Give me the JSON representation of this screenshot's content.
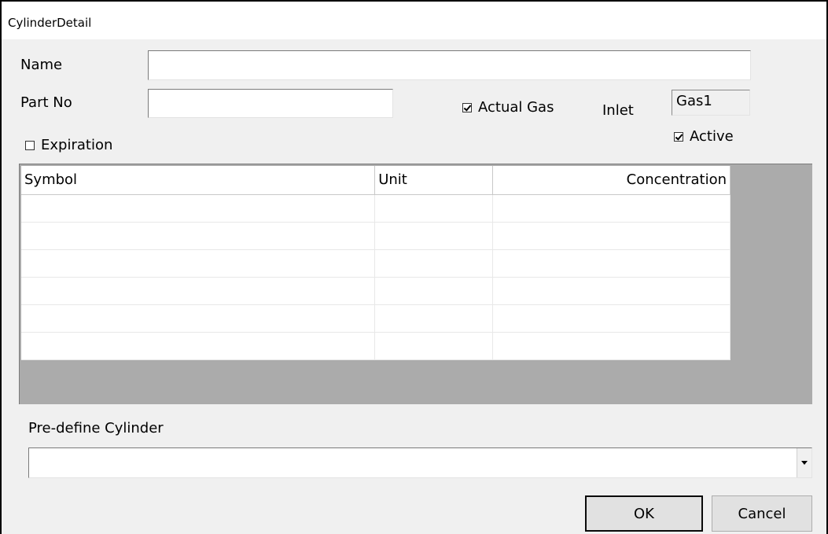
{
  "window": {
    "title": "CylinderDetail"
  },
  "form": {
    "name_label": "Name",
    "name_value": "",
    "partno_label": "Part No",
    "partno_value": "",
    "actual_gas_label": "Actual Gas",
    "actual_gas_checked": true,
    "inlet_label": "Inlet",
    "inlet_value": "Gas1",
    "active_label": "Active",
    "active_checked": true,
    "expiration_label": "Expiration",
    "expiration_checked": false
  },
  "grid": {
    "columns": [
      "Symbol",
      "Unit",
      "Concentration"
    ],
    "rows": [
      [
        "",
        "",
        ""
      ],
      [
        "",
        "",
        ""
      ],
      [
        "",
        "",
        ""
      ],
      [
        "",
        "",
        ""
      ],
      [
        "",
        "",
        ""
      ],
      [
        "",
        "",
        ""
      ]
    ]
  },
  "predefine": {
    "label": "Pre-define Cylinder",
    "selected": ""
  },
  "buttons": {
    "ok": "OK",
    "cancel": "Cancel"
  }
}
